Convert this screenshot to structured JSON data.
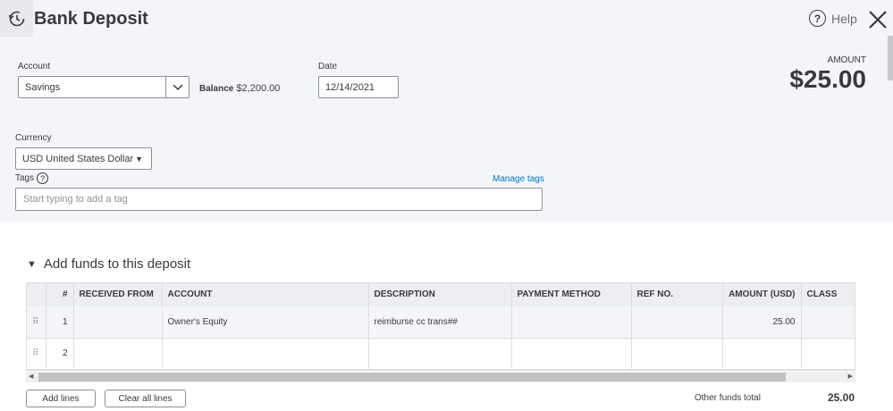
{
  "header": {
    "title": "Bank Deposit",
    "help_label": "Help"
  },
  "form": {
    "account_label": "Account",
    "account_value": "Savings",
    "balance_label": "Balance",
    "balance_value": "$2,200.00",
    "date_label": "Date",
    "date_value": "12/14/2021",
    "amount_label": "AMOUNT",
    "amount_value": "$25.00",
    "currency_label": "Currency",
    "currency_value": "USD United States Dollar",
    "tags_label": "Tags",
    "manage_tags": "Manage tags",
    "tags_placeholder": "Start typing to add a tag"
  },
  "deposit": {
    "section_title": "Add funds to this deposit",
    "columns": [
      "#",
      "RECEIVED FROM",
      "ACCOUNT",
      "DESCRIPTION",
      "PAYMENT METHOD",
      "REF NO.",
      "AMOUNT (USD)",
      "CLASS"
    ],
    "rows": [
      {
        "num": "1",
        "received_from": "",
        "account": "Owner's Equity",
        "description": "reimburse cc trans##",
        "payment_method": "",
        "ref_no": "",
        "amount": "25.00",
        "class": ""
      },
      {
        "num": "2",
        "received_from": "",
        "account": "",
        "description": "",
        "payment_method": "",
        "ref_no": "",
        "amount": "",
        "class": ""
      }
    ],
    "add_lines": "Add lines",
    "clear_all_lines": "Clear all lines",
    "other_funds_label": "Other funds total",
    "other_funds_value": "25.00"
  },
  "icons": {
    "history": "history-clock-icon",
    "help": "help-circle-icon",
    "close": "close-icon",
    "chevron": "chevron-down-icon",
    "drag": "drag-handle-icon"
  },
  "colors": {
    "link": "#0077c5",
    "panel_bg": "#f4f5f8",
    "text": "#393a3d"
  }
}
